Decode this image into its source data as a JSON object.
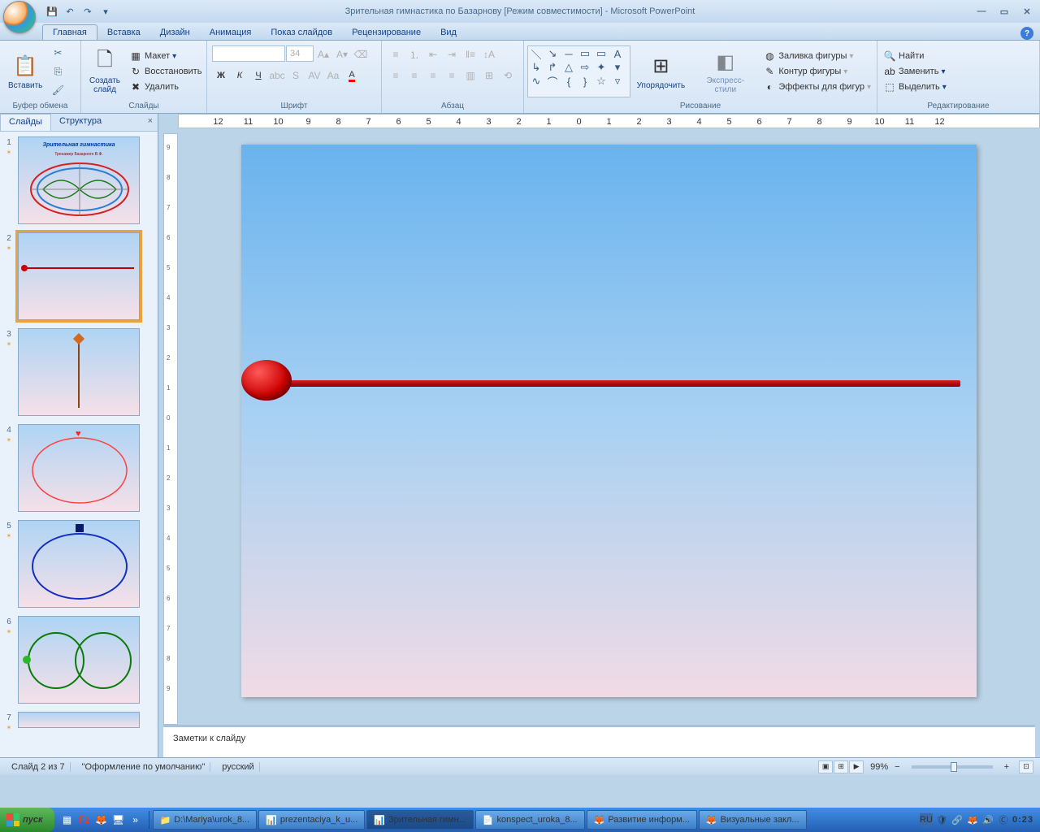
{
  "title": "Зрительная гимнастика по Базарнову [Режим совместимости] - Microsoft PowerPoint",
  "tabs": {
    "home": "Главная",
    "insert": "Вставка",
    "design": "Дизайн",
    "anim": "Анимация",
    "show": "Показ слайдов",
    "review": "Рецензирование",
    "view": "Вид"
  },
  "ribbon": {
    "clipboard": {
      "label": "Буфер обмена",
      "paste": "Вставить"
    },
    "slides": {
      "label": "Слайды",
      "new": "Создать\nслайд",
      "layout": "Макет",
      "reset": "Восстановить",
      "delete": "Удалить"
    },
    "font": {
      "label": "Шрифт",
      "size": "34"
    },
    "paragraph": {
      "label": "Абзац"
    },
    "drawing": {
      "label": "Рисование",
      "arrange": "Упорядочить",
      "styles": "Экспресс-стили",
      "fill": "Заливка фигуры",
      "outline": "Контур фигуры",
      "effects": "Эффекты для фигур"
    },
    "editing": {
      "label": "Редактирование",
      "find": "Найти",
      "replace": "Заменить",
      "select": "Выделить"
    }
  },
  "panel": {
    "slides": "Слайды",
    "outline": "Структура"
  },
  "thumbs": {
    "t1_title": "Зрительная гимнастика",
    "t1_sub": "Тренажер Базарного В.Ф."
  },
  "ruler_h": [
    "12",
    "11",
    "10",
    "9",
    "8",
    "7",
    "6",
    "5",
    "4",
    "3",
    "2",
    "1",
    "0",
    "1",
    "2",
    "3",
    "4",
    "5",
    "6",
    "7",
    "8",
    "9",
    "10",
    "11",
    "12"
  ],
  "ruler_v": [
    "9",
    "8",
    "7",
    "6",
    "5",
    "4",
    "3",
    "2",
    "1",
    "0",
    "1",
    "2",
    "3",
    "4",
    "5",
    "6",
    "7",
    "8",
    "9"
  ],
  "notes": "Заметки к слайду",
  "status": {
    "slide": "Слайд 2 из 7",
    "theme": "\"Оформление по умолчанию\"",
    "lang": "русский",
    "zoom": "99%"
  },
  "taskbar": {
    "start": "пуск",
    "tasks": [
      {
        "icon": "📁",
        "label": "D:\\Mariya\\urok_8..."
      },
      {
        "icon": "📊",
        "label": "prezentaciya_k_u..."
      },
      {
        "icon": "📊",
        "label": "Зрительная гимн...",
        "active": true
      },
      {
        "icon": "📄",
        "label": "konspect_uroka_8..."
      },
      {
        "icon": "🦊",
        "label": "Развитие информ..."
      },
      {
        "icon": "🦊",
        "label": "Визуальные закл..."
      }
    ],
    "lang": "RU",
    "time": "0:23"
  }
}
